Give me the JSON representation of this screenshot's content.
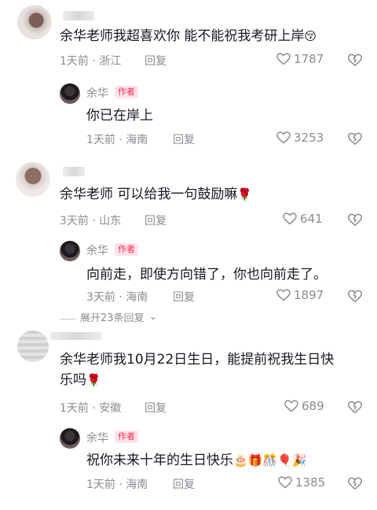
{
  "comments": [
    {
      "text": "余华老师我超喜欢你 能不能祝我考研上岸",
      "emoji": "😚",
      "time": "1天前",
      "location": "浙江",
      "reply_label": "回复",
      "likes": "1787",
      "reply": {
        "author": "余华",
        "badge": "作者",
        "text": "你已在岸上",
        "time": "1天前",
        "location": "海南",
        "reply_label": "回复",
        "likes": "3253"
      }
    },
    {
      "text": "余华老师 可以给我一句鼓励嘛",
      "emoji": "🌹",
      "time": "3天前",
      "location": "山东",
      "reply_label": "回复",
      "likes": "641",
      "reply": {
        "author": "余华",
        "badge": "作者",
        "text": "向前走，即使方向错了，你也向前走了。",
        "time": "3天前",
        "location": "海南",
        "reply_label": "回复",
        "likes": "1897"
      },
      "expand": "展开23条回复"
    },
    {
      "text_line1": "余华老师我10月22日生日，能提前祝我生日快",
      "text_line2": "乐吗",
      "emoji": "🌹",
      "time": "1天前",
      "location": "安徽",
      "reply_label": "回复",
      "likes": "689",
      "reply": {
        "author": "余华",
        "badge": "作者",
        "text": "祝你未来十年的生日快乐",
        "emoji": "🎂🎁🎊🎈🎉",
        "time": "1天前",
        "location": "海南",
        "reply_label": "回复",
        "likes": "1385"
      }
    }
  ],
  "colors": {
    "accent": "#fe2c55",
    "meta": "#8a8b91",
    "text": "#161823"
  },
  "icons": {
    "like": "heart-outline-icon",
    "dislike": "broken-heart-icon",
    "expand": "chevron-down-icon"
  }
}
